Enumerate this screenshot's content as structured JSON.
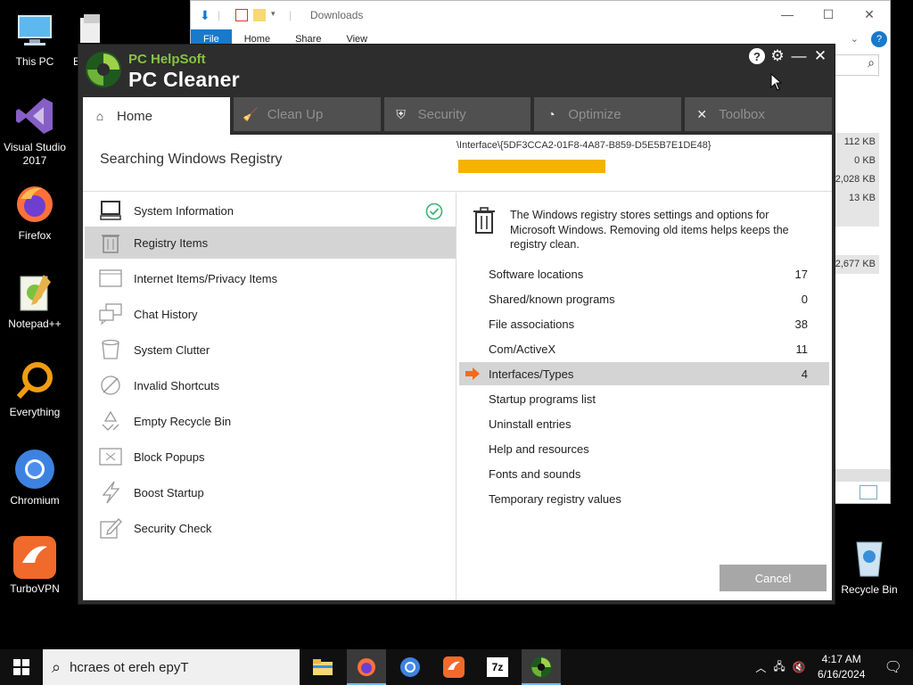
{
  "desktop": {
    "icons": [
      {
        "label": "This PC"
      },
      {
        "label": "Visual Studio 2017"
      },
      {
        "label": "Firefox"
      },
      {
        "label": "Notepad++"
      },
      {
        "label": "Everything"
      },
      {
        "label": "Chromium"
      },
      {
        "label": "TurboVPN"
      },
      {
        "label": "E"
      },
      {
        "label": "Recycle Bin"
      }
    ]
  },
  "explorer": {
    "title": "Downloads",
    "ribbon": [
      "File",
      "Home",
      "Share",
      "View"
    ],
    "sizes": [
      "112 KB",
      "0 KB",
      "2,028 KB",
      "13 KB",
      "",
      "2,677 KB"
    ]
  },
  "app": {
    "brand_line1": "PC HelpSoft",
    "brand_line2": "PC Cleaner",
    "tabs": [
      {
        "label": "Home",
        "icon": "home-icon"
      },
      {
        "label": "Clean Up",
        "icon": "cleanup-icon"
      },
      {
        "label": "Security",
        "icon": "shield-icon"
      },
      {
        "label": "Optimize",
        "icon": "gauge-icon"
      },
      {
        "label": "Toolbox",
        "icon": "tools-icon"
      }
    ],
    "status_title": "Searching Windows Registry",
    "registry_path": "\\Interface\\{5DF3CCA2-01F8-4A87-B859-D5E5B7E1DE48}",
    "progress": 0.4,
    "scan_items": [
      {
        "label": "System Information",
        "done": true
      },
      {
        "label": "Registry Items",
        "selected": true
      },
      {
        "label": "Internet Items/Privacy Items"
      },
      {
        "label": "Chat History"
      },
      {
        "label": "System Clutter"
      },
      {
        "label": "Invalid Shortcuts"
      },
      {
        "label": "Empty Recycle Bin"
      },
      {
        "label": "Block Popups"
      },
      {
        "label": "Boost Startup"
      },
      {
        "label": "Security Check"
      }
    ],
    "description": "The Windows registry stores settings and options for Microsoft Windows. Removing old items helps keeps the registry clean.",
    "categories": [
      {
        "name": "Software locations",
        "count": "17"
      },
      {
        "name": "Shared/known programs",
        "count": "0"
      },
      {
        "name": "File associations",
        "count": "38"
      },
      {
        "name": "Com/ActiveX",
        "count": "11"
      },
      {
        "name": "Interfaces/Types",
        "count": "4",
        "current": true
      },
      {
        "name": "Startup programs list",
        "count": ""
      },
      {
        "name": "Uninstall entries",
        "count": ""
      },
      {
        "name": "Help and resources",
        "count": ""
      },
      {
        "name": "Fonts and sounds",
        "count": ""
      },
      {
        "name": "Temporary registry values",
        "count": ""
      }
    ],
    "cancel_label": "Cancel",
    "colors": {
      "accent_green": "#86c440",
      "progress": "#f5b300",
      "arrow": "#f26b1d"
    }
  },
  "taskbar": {
    "search_text": "hcraes ot ereh epyT",
    "time": "4:17 AM",
    "date": "6/16/2024"
  }
}
